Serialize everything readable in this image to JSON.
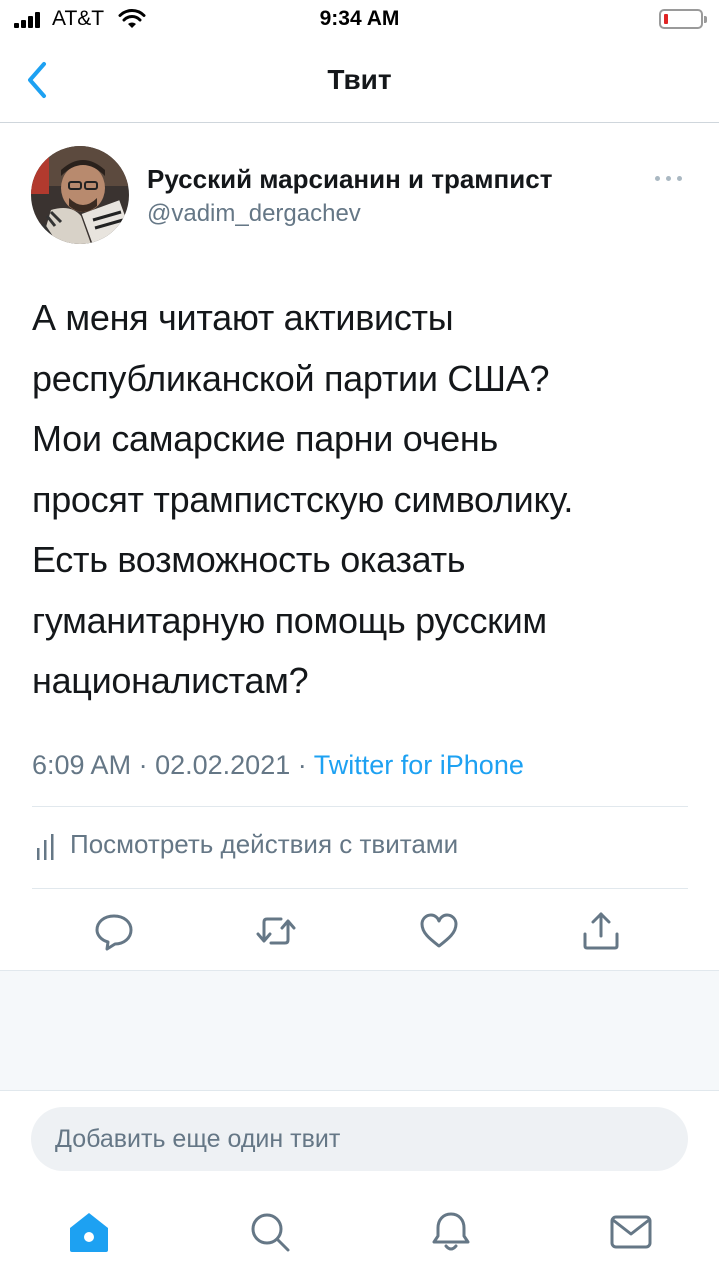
{
  "status_bar": {
    "carrier": "AT&T",
    "time": "9:34 AM",
    "icons": [
      "signal-icon",
      "wifi-icon",
      "battery-low-icon"
    ],
    "battery_level": 0.1
  },
  "nav": {
    "title": "Твит",
    "back_icon": "chevron-left-icon"
  },
  "tweet": {
    "display_name": "Русский марсианин и трампист",
    "handle": "@vadim_dergachev",
    "text_lines": [
      "А меня читают активисты",
      "республиканской партии США?",
      "Мои самарские парни очень",
      "просят трампистскую символику.",
      "Есть возможность оказать",
      "гуманитарную помощь русским",
      "националистам?"
    ],
    "time": "6:09 AM",
    "separator": "·",
    "date": "02.02.2021",
    "source": "Twitter for iPhone",
    "activity_label": "Посмотреть действия с твитами",
    "actions": [
      "reply-icon",
      "retweet-icon",
      "like-icon",
      "share-icon"
    ]
  },
  "reply": {
    "placeholder": "Добавить еще один твит"
  },
  "tabs": [
    "home-icon",
    "search-icon",
    "notifications-icon",
    "messages-icon"
  ],
  "colors": {
    "accent": "#1da1f2",
    "text": "#14171a",
    "secondary": "#657786",
    "icon": "#657786",
    "battery": "#e02424"
  }
}
